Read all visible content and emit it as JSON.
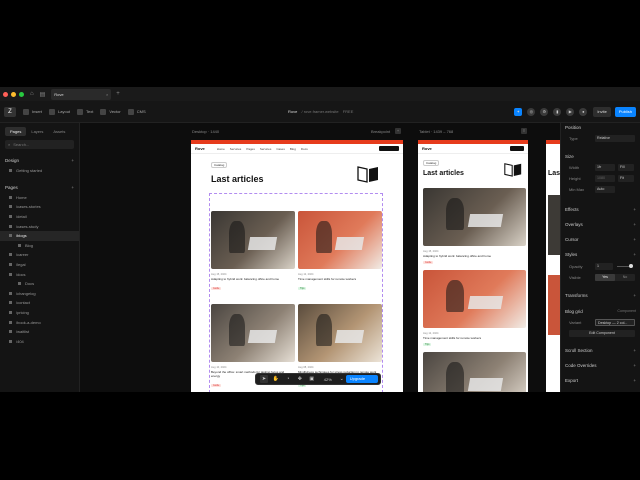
{
  "window": {
    "tab_title": "Rove",
    "doc_title": "Rove",
    "doc_subtitle": "/ rove.framer.website",
    "doc_badge": "FREE"
  },
  "toolbar": {
    "logo": "Z",
    "items": [
      "Insert",
      "Layout",
      "Text",
      "Vector",
      "CMS"
    ],
    "invite": "Invite",
    "publish": "Publish"
  },
  "left_panel": {
    "tabs": [
      "Pages",
      "Layers",
      "Assets"
    ],
    "search_placeholder": "Search...",
    "design_title": "Design",
    "design_items": [
      "Getting started"
    ],
    "pages_title": "Pages",
    "pages": [
      {
        "label": "Home",
        "selected": false,
        "sub": false
      },
      {
        "label": "/cases-stories",
        "selected": false,
        "sub": false
      },
      {
        "label": "/detail",
        "selected": false,
        "sub": false
      },
      {
        "label": "/cases-study",
        "selected": false,
        "sub": false
      },
      {
        "label": "/blogs",
        "selected": true,
        "sub": false
      },
      {
        "label": "Blog",
        "selected": false,
        "sub": true
      },
      {
        "label": "/career",
        "selected": false,
        "sub": false
      },
      {
        "label": "/legal",
        "selected": false,
        "sub": false
      },
      {
        "label": "/docs",
        "selected": false,
        "sub": false
      },
      {
        "label": "Docs",
        "selected": false,
        "sub": true
      },
      {
        "label": "/changelog",
        "selected": false,
        "sub": false
      },
      {
        "label": "/contact",
        "selected": false,
        "sub": false
      },
      {
        "label": "/pricing",
        "selected": false,
        "sub": false
      },
      {
        "label": "/book-a-demo",
        "selected": false,
        "sub": false
      },
      {
        "label": "/waitlist",
        "selected": false,
        "sub": false
      },
      {
        "label": "/404",
        "selected": false,
        "sub": false
      }
    ]
  },
  "canvas": {
    "desktop_label": "Desktop · 1440",
    "breakpoint_label": "Breakpoint",
    "tablet_label": "Tablet · 1439 – 768",
    "site": {
      "logo": "Rove",
      "nav_links": [
        "Home",
        "Services",
        "Pages",
        "Services",
        "Cases",
        "Blog",
        "Docs"
      ],
      "chip": "Catalog",
      "heading": "Last articles",
      "cards": [
        {
          "date": "Aug 15, 2024",
          "title": "Adapting to hybrid work: balancing office and home",
          "tag": "Guide",
          "tag_color": "red"
        },
        {
          "date": "Aug 12, 2024",
          "title": "Time management skills for remote workers",
          "tag": "Tips",
          "tag_color": "green"
        },
        {
          "date": "Aug 10, 2024",
          "title": "Beyond the office: smart methods for tasking focus and energy",
          "tag": "Guide",
          "tag_color": "red"
        },
        {
          "date": "Aug 08, 2024",
          "title": "Mindfulness techniques for stress reduction in remote work",
          "tag": "Tips",
          "tag_color": "green"
        }
      ]
    }
  },
  "float_bar": {
    "zoom": "42%",
    "upgrade": "Upgrade Now"
  },
  "right_panel": {
    "position_title": "Position",
    "type_label": "Type",
    "type_value": "Relative",
    "size_title": "Size",
    "width_label": "Width",
    "width_value": "1fr",
    "width_mode": "Fill",
    "height_label": "Height",
    "height_value": "1080",
    "height_mode": "Fit",
    "minmax_label": "Min Max",
    "minmax_value": "Auto",
    "effects_title": "Effects",
    "overlays_title": "Overlays",
    "cursor_title": "Cursor",
    "styles_title": "Styles",
    "opacity_label": "Opacity",
    "opacity_value": "1",
    "visible_label": "Visible",
    "visible_yes": "Yes",
    "visible_no": "No",
    "transforms_title": "Transforms",
    "blog_grid_title": "Blog grid",
    "blog_grid_kind": "Component",
    "variant_label": "Variant",
    "variant_value": "Desktop — 2 col...",
    "edit_component": "Edit Component",
    "scroll_section_title": "Scroll Section",
    "code_overrides_title": "Code Overrides",
    "export_title": "Export"
  },
  "colors": {
    "accent": "#0a84ff",
    "banner": "#e63b1c",
    "selection": "#b28cf0"
  }
}
